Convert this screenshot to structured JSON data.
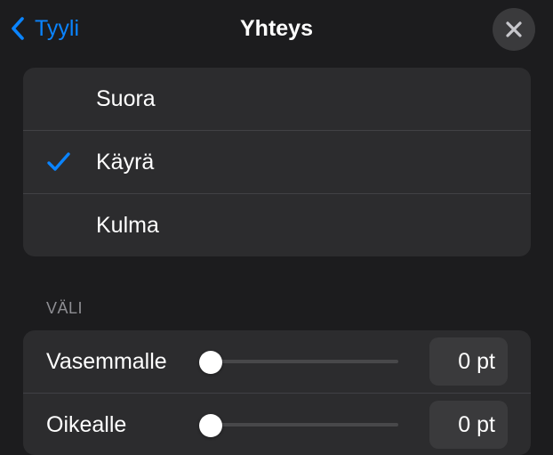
{
  "header": {
    "back_label": "Tyyli",
    "title": "Yhteys"
  },
  "connection_styles": {
    "options": [
      {
        "label": "Suora",
        "selected": false
      },
      {
        "label": "Käyrä",
        "selected": true
      },
      {
        "label": "Kulma",
        "selected": false
      }
    ]
  },
  "spacing": {
    "section_title": "VÄLI",
    "rows": [
      {
        "label": "Vasemmalle",
        "value": "0 pt",
        "slider_fraction": 0
      },
      {
        "label": "Oikealle",
        "value": "0 pt",
        "slider_fraction": 0
      }
    ]
  },
  "colors": {
    "accent": "#0a84ff",
    "background": "#1c1c1e",
    "group_background": "#2c2c2e"
  },
  "icons": {
    "back": "chevron-left-icon",
    "close": "close-icon",
    "selected": "checkmark-icon"
  }
}
